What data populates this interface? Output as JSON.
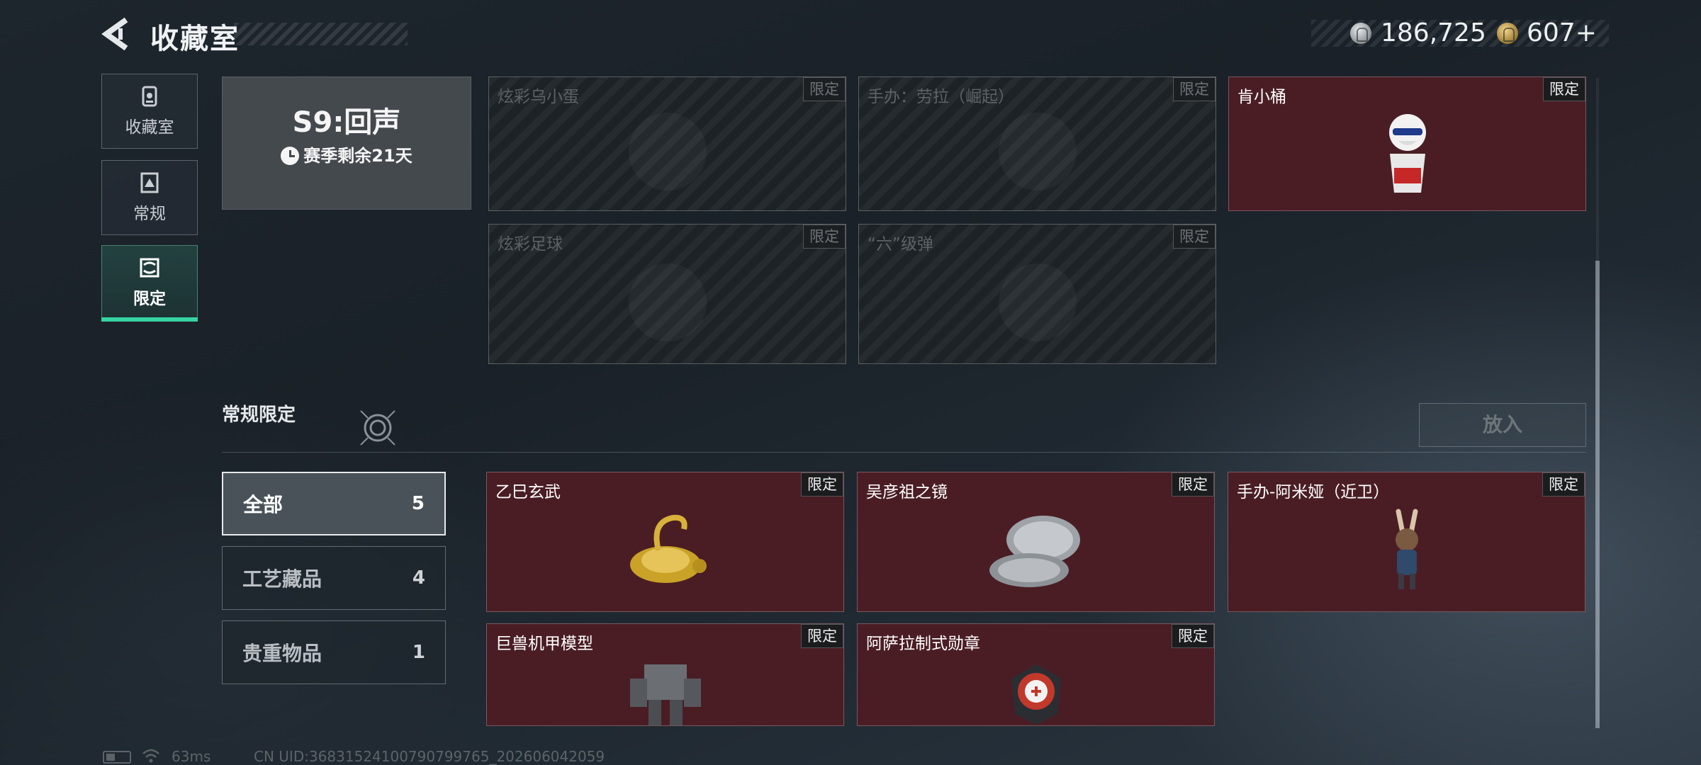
{
  "header": {
    "title": "收藏室",
    "currency_silver": "186,725",
    "currency_gold": "607+"
  },
  "nav": [
    {
      "label": "收藏室",
      "icon": "collection-room-icon",
      "active": false
    },
    {
      "label": "常规",
      "icon": "regular-icon",
      "active": false
    },
    {
      "label": "限定",
      "icon": "limited-icon",
      "active": true
    }
  ],
  "season": {
    "title": "S9:回声",
    "remaining": "赛季剩余21天"
  },
  "season_items": [
    {
      "name": "炫彩乌小蛋",
      "badge": "限定",
      "owned": false
    },
    {
      "name": "手办：劳拉（崛起）",
      "badge": "限定",
      "owned": false
    },
    {
      "name": "肯小桶",
      "badge": "限定",
      "owned": true
    },
    {
      "name": "炫彩足球",
      "badge": "限定",
      "owned": false
    },
    {
      "name": "“六”级弹",
      "badge": "限定",
      "owned": false
    }
  ],
  "section": {
    "title": "常规限定",
    "put_button": "放入"
  },
  "filters": [
    {
      "label": "全部",
      "count": "5",
      "active": true
    },
    {
      "label": "工艺藏品",
      "count": "4",
      "active": false
    },
    {
      "label": "贵重物品",
      "count": "1",
      "active": false
    }
  ],
  "regular_items": [
    {
      "name": "乙巳玄武",
      "badge": "限定"
    },
    {
      "name": "吴彦祖之镜",
      "badge": "限定"
    },
    {
      "name": "手办-阿米娅（近卫）",
      "badge": "限定"
    },
    {
      "name": "巨兽机甲模型",
      "badge": "限定"
    },
    {
      "name": "阿萨拉制式勋章",
      "badge": "限定"
    }
  ],
  "footer": {
    "ping": "63ms",
    "uid": "CN UID:3683152410079079​9765_202606042059"
  },
  "colors": {
    "accent": "#35d4a0",
    "owned_card": "#4a1d24",
    "locked_card": "#1d2226"
  }
}
